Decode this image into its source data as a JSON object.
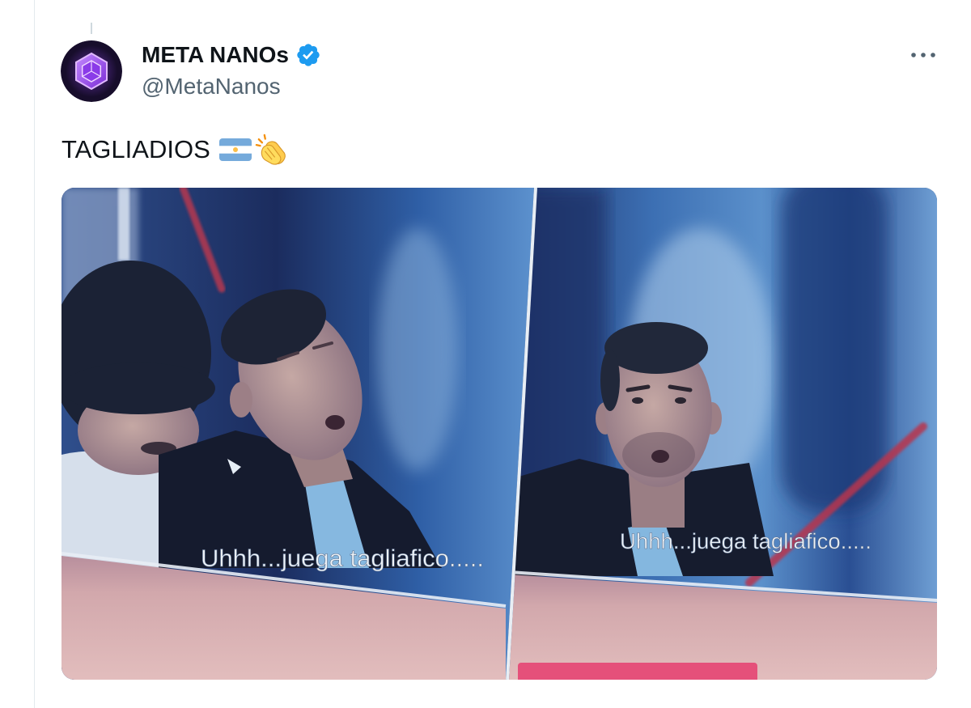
{
  "tweet": {
    "author": {
      "display_name": "META NANOs",
      "handle": "@MetaNanos",
      "verified": true,
      "avatar_icon": "purple-hexagon-logo-icon",
      "verified_icon": "verified-badge-icon"
    },
    "more_icon": "more-options-icon",
    "text": "TAGLIADIOS",
    "text_emojis": [
      "flag-argentina-icon",
      "clapping-hands-icon"
    ],
    "media": {
      "frames": [
        {
          "caption": "Uhhh...juega tagliafico....."
        },
        {
          "caption": "Uhhh...juega tagliafico....."
        }
      ]
    }
  },
  "colors": {
    "text_primary": "#0f1419",
    "text_secondary": "#536471",
    "verified_blue": "#1d9bf0",
    "avatar_purple": "#a855f7",
    "divider": "#e3e9ed"
  }
}
